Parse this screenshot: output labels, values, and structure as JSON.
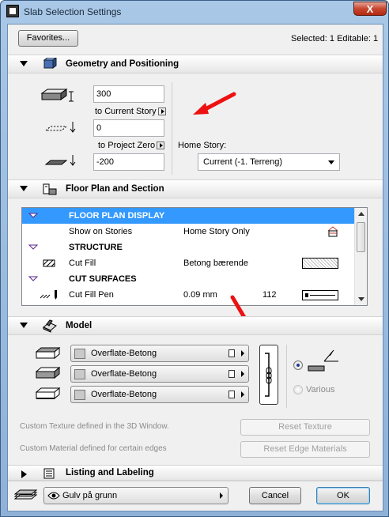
{
  "window": {
    "title": "Slab Selection Settings",
    "close_label": "X"
  },
  "top": {
    "favorites_label": "Favorites...",
    "selection_info": "Selected: 1 Editable: 1"
  },
  "geometry": {
    "section_label": "Geometry and Positioning",
    "thickness_value": "300",
    "to_current_story_label": "to Current Story",
    "offset_value": "0",
    "to_project_zero_label": "to Project Zero",
    "elevation_value": "-200",
    "home_story_label": "Home Story:",
    "home_story_value": "Current (-1. Terreng)"
  },
  "floorplan": {
    "section_label": "Floor Plan and Section",
    "rows": [
      {
        "name": "FLOOR PLAN DISPLAY",
        "value": "",
        "extra": "",
        "header": true,
        "selected": true
      },
      {
        "name": "Show on Stories",
        "value": "Home Story Only",
        "extra": "",
        "header": false,
        "selected": false
      },
      {
        "name": "STRUCTURE",
        "value": "",
        "extra": "",
        "header": true,
        "selected": false
      },
      {
        "name": "Cut Fill",
        "value": "Betong bærende",
        "extra": "",
        "header": false,
        "selected": false
      },
      {
        "name": "CUT SURFACES",
        "value": "",
        "extra": "",
        "header": true,
        "selected": false
      },
      {
        "name": "Cut Fill Pen",
        "value": "0.09 mm",
        "extra": "112",
        "header": false,
        "selected": false
      }
    ]
  },
  "model": {
    "section_label": "Model",
    "top_material": "Overflate-Betong",
    "side_material": "Overflate-Betong",
    "bottom_material": "Overflate-Betong",
    "various_label": "Various",
    "custom_texture_note": "Custom Texture defined in the 3D Window.",
    "custom_material_note": "Custom Material defined for certain edges",
    "reset_texture_label": "Reset Texture",
    "reset_edge_label": "Reset Edge Materials"
  },
  "listing": {
    "section_label": "Listing and Labeling"
  },
  "bottom": {
    "layer_value": "Gulv på grunn",
    "cancel_label": "Cancel",
    "ok_label": "OK"
  },
  "colors": {
    "selection": "#3399ff",
    "annotation_arrow": "#ee1111"
  }
}
